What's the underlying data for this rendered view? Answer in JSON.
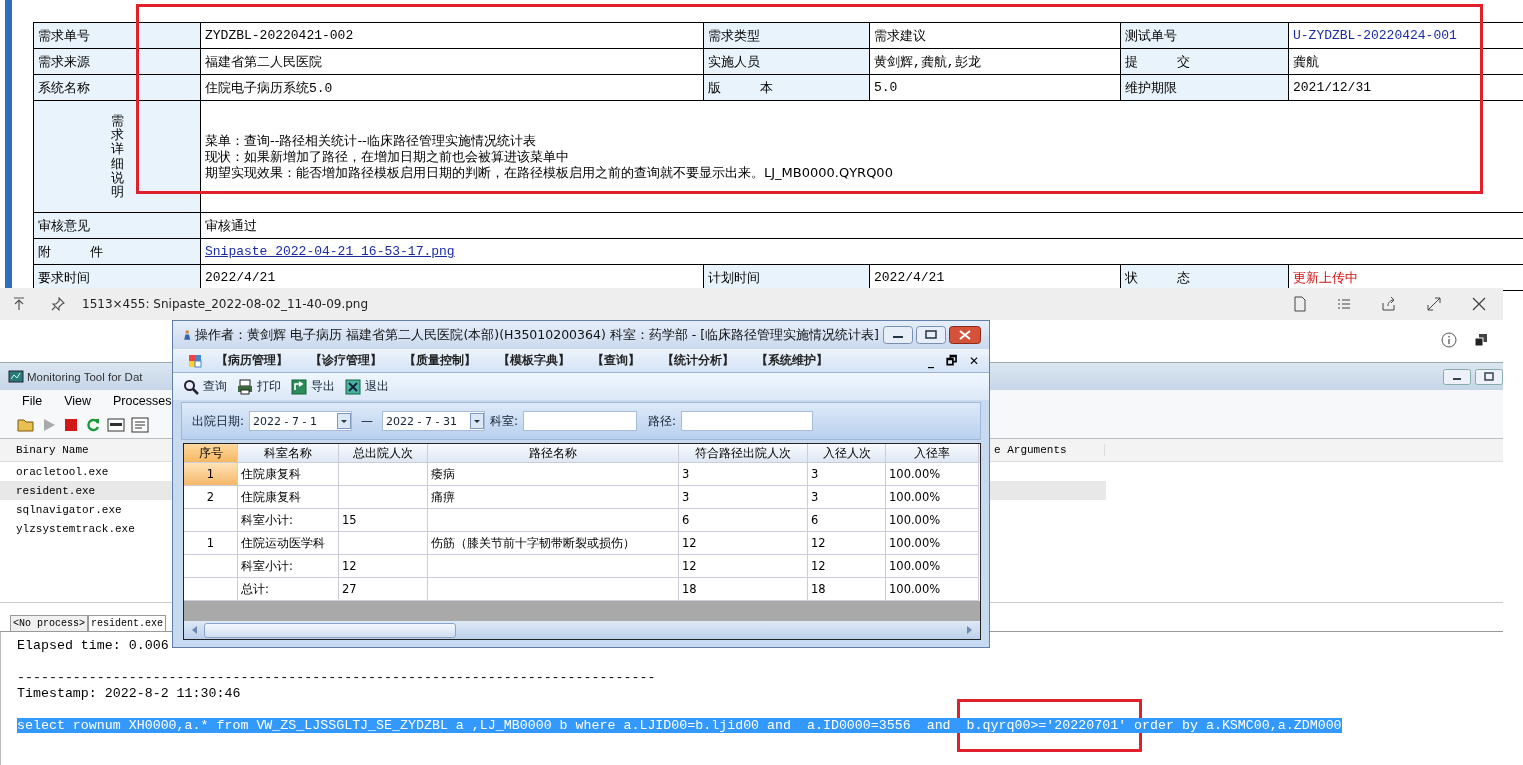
{
  "request_form": {
    "rows": [
      {
        "fields": [
          {
            "kind": "plain",
            "label": "需求单号",
            "value": "ZYDZBL-20220421-002"
          },
          {
            "kind": "plain",
            "label": "需求类型",
            "value": "需求建议"
          },
          {
            "kind": "ref",
            "label": "测试单号",
            "value": "U-ZYDZBL-20220424-001"
          }
        ]
      },
      {
        "fields": [
          {
            "kind": "plain",
            "label": "需求来源",
            "value": "福建省第二人民医院"
          },
          {
            "kind": "plain",
            "label": "实施人员",
            "value": "黄剑辉,龚航,彭龙"
          },
          {
            "kind": "plain",
            "label": "提　　　交",
            "value": "龚航"
          }
        ]
      },
      {
        "fields": [
          {
            "kind": "plain",
            "label": "系统名称",
            "value": "住院电子病历系统5.0"
          },
          {
            "kind": "plain",
            "label": "版　　　本",
            "value": "5.0"
          },
          {
            "kind": "plain",
            "label": "维护期限",
            "value": "2021/12/31"
          }
        ]
      },
      {
        "fields": [
          {
            "kind": "detail",
            "label": "需求详细说明",
            "lines": [
              "菜单：查询--路径相关统计--临床路径管理实施情况统计表",
              "现状：如果新增加了路径，在增加日期之前也会被算进该菜单中",
              "期望实现效果：能否增加路径模板启用日期的判断，在路径模板启用之前的查询就不要显示出来。LJ_MB0000.QYRQ00"
            ]
          }
        ]
      },
      {
        "fields": [
          {
            "kind": "plain",
            "label": "审核意见",
            "value": "审核通过"
          }
        ]
      },
      {
        "fields": [
          {
            "kind": "link",
            "label": "附　　　件",
            "value": "Snipaste_2022-04-21_16-53-17.png"
          }
        ]
      },
      {
        "fields": [
          {
            "kind": "plain",
            "label": "要求时间",
            "value": "2022/4/21"
          },
          {
            "kind": "plain",
            "label": "计划时间",
            "value": "2022/4/21"
          },
          {
            "kind": "alert",
            "label": "状　　　态",
            "value": "更新上传中"
          }
        ]
      }
    ]
  },
  "viewer": {
    "title": "1513×455: Snipaste_2022-08-02_11-40-09.png"
  },
  "monitor": {
    "title": "Monitoring Tool for Dat",
    "menu": [
      "File",
      "View",
      "Processes"
    ],
    "columns": [
      "Binary Name",
      "e Arguments"
    ],
    "processes": [
      {
        "name": "oracletool.exe",
        "selected": false
      },
      {
        "name": "resident.exe",
        "selected": true
      },
      {
        "name": "sqlnavigator.exe",
        "selected": false
      },
      {
        "name": "ylzsystemtrack.exe",
        "selected": false
      }
    ],
    "tabs": [
      {
        "label": "<No process>",
        "selected": false
      },
      {
        "label": "resident.exe",
        "selected": true
      }
    ],
    "log": [
      {
        "kind": "text",
        "text": "Elapsed time: 0.006"
      },
      {
        "kind": "blank"
      },
      {
        "kind": "text",
        "text": "--------------------------------------------------------------------------------"
      },
      {
        "kind": "text",
        "text": "Timestamp: 2022-8-2 11:30:46"
      },
      {
        "kind": "blank"
      },
      {
        "kind": "highlight",
        "text": "select rownum XH0000,a.* from VW_ZS_LJSSGLTJ_SE_ZYDZBL a ,LJ_MB0000 b where a.LJID00=b.ljid00 and  a.ID0000=3556  and  b.qyrq00>='20220701' order by a.KSMC00,a.ZDM000"
      }
    ]
  },
  "app": {
    "title": "操作者：黄剑辉 电子病历  福建省第二人民医院(本部)(H35010200364)  科室：药学部 - [临床路径管理实施情况统计表]",
    "menu": [
      "【病历管理】",
      "【诊疗管理】",
      "【质量控制】",
      "【模板字典】",
      "【查询】",
      "【统计分析】",
      "【系统维护】"
    ],
    "mdi_controls": [
      "_",
      "🗗",
      "✕"
    ],
    "toolbar": [
      {
        "kind": "search",
        "label": "查询"
      },
      {
        "kind": "print",
        "label": "打印"
      },
      {
        "kind": "export",
        "label": "导出"
      },
      {
        "kind": "exit",
        "label": "退出"
      }
    ],
    "filters": {
      "date_label": "出院日期:",
      "date_from": "2022 - 7 - 1",
      "separator": "—",
      "date_to": "2022 - 7 - 31",
      "dept_label": "科室:",
      "path_label": "路径:"
    },
    "grid": {
      "columns": [
        "序号",
        "科室名称",
        "总出院人次",
        "路径名称",
        "符合路径出院人次",
        "入径人次",
        "入径率"
      ],
      "rows": [
        {
          "selected": true,
          "cells": [
            "1",
            "住院康复科",
            "",
            "痿病",
            "3",
            "3",
            "100.00%"
          ]
        },
        {
          "selected": false,
          "cells": [
            "2",
            "住院康复科",
            "",
            "痛痹",
            "3",
            "3",
            "100.00%"
          ]
        },
        {
          "selected": false,
          "cells": [
            "",
            "科室小计:",
            "15",
            "",
            "6",
            "6",
            "100.00%"
          ]
        },
        {
          "selected": false,
          "cells": [
            "1",
            "住院运动医学科",
            "",
            "伤筋（膝关节前十字韧带断裂或损伤）",
            "12",
            "12",
            "100.00%"
          ]
        },
        {
          "selected": false,
          "cells": [
            "",
            "科室小计:",
            "12",
            "",
            "12",
            "12",
            "100.00%"
          ]
        },
        {
          "selected": false,
          "cells": [
            "",
            "总计:",
            "27",
            "",
            "18",
            "18",
            "100.00%"
          ]
        }
      ]
    }
  }
}
